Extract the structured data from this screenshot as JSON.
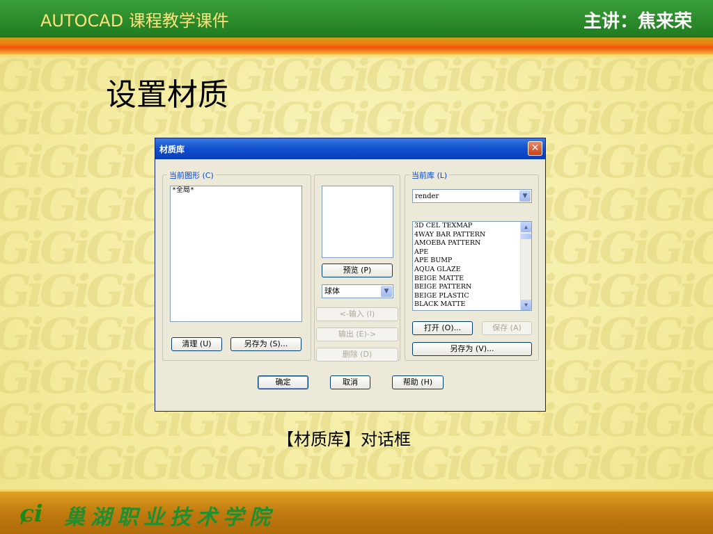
{
  "header": {
    "title": "AUTOCAD 课程教学课件",
    "author": "主讲：焦来荣"
  },
  "slide": {
    "heading": "设置材质",
    "caption": "【材质库】对话框"
  },
  "footer": {
    "logo": "ɕi",
    "school": "巢湖职业技术学院"
  },
  "watermark_text": "GiGiGiGiGiGiGiGiGiGiGiGiGiGiGiGi",
  "dialog": {
    "title": "材质库",
    "close": "✕",
    "current_drawing": {
      "legend": "当前图形 (C)",
      "items": [
        "*全局*"
      ],
      "purge": "清理 (U)",
      "save_as": "另存为 (S)..."
    },
    "preview": {
      "button": "预览 (P)",
      "shape": "球体",
      "import": "<-输入 (I)",
      "export": "输出 (E)->",
      "delete": "删除 (D)"
    },
    "current_library": {
      "legend": "当前库 (L)",
      "library": "render",
      "items": [
        "3D CEL TEXMAP",
        "4WAY BAR PATTERN",
        "AMOEBA PATTERN",
        "APE",
        "APE BUMP",
        "AQUA GLAZE",
        "BEIGE MATTE",
        "BEIGE PATTERN",
        "BEIGE PLASTIC",
        "BLACK MATTE"
      ],
      "open": "打开 (O)...",
      "save": "保存 (A)",
      "save_as": "另存为 (V)..."
    },
    "ok": "确定",
    "cancel": "取消",
    "help": "帮助 (H)"
  },
  "colors": {
    "header_bg": "#2a8f2a",
    "footer_bg": "#c88414",
    "dialog_bg": "#ece9d8",
    "titlebar": "#0f4fd0"
  }
}
